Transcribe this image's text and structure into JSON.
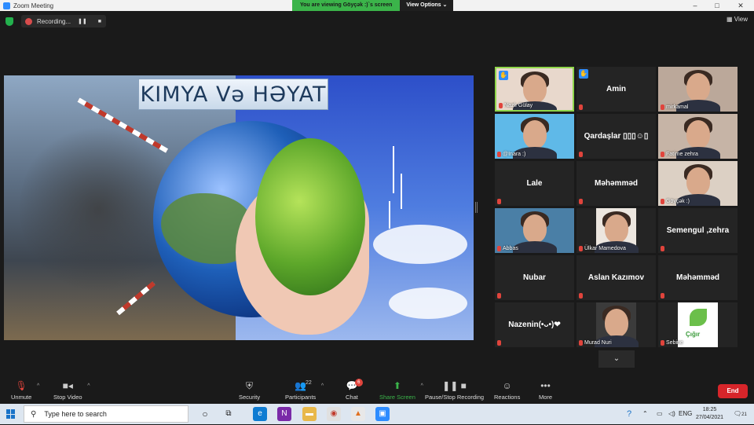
{
  "window": {
    "title": "Zoom Meeting",
    "min": "–",
    "max": "□",
    "close": "✕"
  },
  "share_banner": {
    "text": "You are viewing Göyçək :)`s screen",
    "options": "View Options ⌄"
  },
  "topbar": {
    "recording": "Recording...",
    "pause": "❚❚",
    "stop": "■",
    "view": "View"
  },
  "slide": {
    "title": "KIMYA Və HƏYAT"
  },
  "participants": [
    {
      "label": "Nazlı Gülay",
      "raised": true,
      "active": true
    },
    {
      "name": "Amin",
      "raised": true
    },
    {
      "label": "mirkamal"
    },
    {
      "label": "@Inara :)"
    },
    {
      "name": "Qardaşlar ▯▯▯☺▯"
    },
    {
      "label": "Fatime zehra"
    },
    {
      "name": "Lale"
    },
    {
      "name": "Məhəmməd"
    },
    {
      "label": "Göyçək :)"
    },
    {
      "label": "Abbas"
    },
    {
      "label": "Ülkar Mamedova"
    },
    {
      "name": "Semengul ,zehra"
    },
    {
      "name": "Nubar"
    },
    {
      "name": "Aslan Kazımov"
    },
    {
      "name": "Məhəmməd"
    },
    {
      "name": "Nazenin(•ᴗ•)❤"
    },
    {
      "label": "Murad Nuri"
    },
    {
      "label": "Sebine",
      "logo": "Çığır"
    }
  ],
  "toolbar": {
    "unmute": "Unmute",
    "stop_video": "Stop Video",
    "security": "Security",
    "participants": "Participants",
    "participant_count": "22",
    "chat": "Chat",
    "chat_badge": "6",
    "share_screen": "Share Screen",
    "pause_recording": "Pause/Stop Recording",
    "reactions": "Reactions",
    "more": "More",
    "end": "End"
  },
  "taskbar": {
    "search_placeholder": "Type here to search",
    "lang": "ENG",
    "time": "18:25",
    "date": "27/04/2021",
    "notif_count": "21"
  },
  "colors": {
    "zoom_blue": "#2d8cff",
    "share_green": "#3bb44a",
    "end_red": "#d7252a",
    "active_border": "#8fd64a"
  }
}
